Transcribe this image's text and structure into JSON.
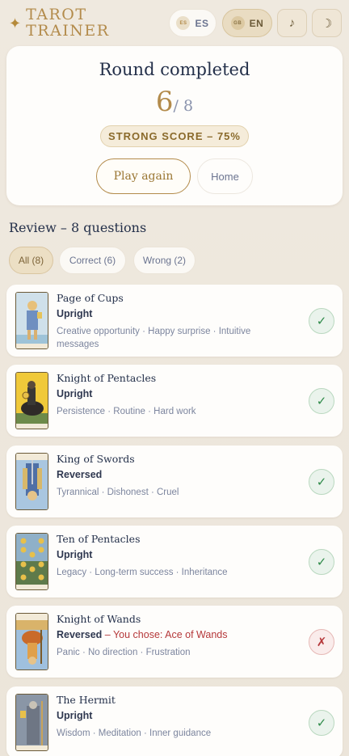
{
  "header": {
    "brand_line1": "TAROT",
    "brand_line2": "TRAINER",
    "star_icon": "✦",
    "lang_es": {
      "flag": "ES",
      "label": "ES"
    },
    "lang_en": {
      "flag": "GB",
      "label": "EN"
    },
    "music_icon": "♪",
    "moon_icon": "☽"
  },
  "score": {
    "title": "Round completed",
    "correct": "6",
    "total": "/ 8",
    "badge": "STRONG SCORE – 75%",
    "play_again": "Play again",
    "home": "Home"
  },
  "review": {
    "title": "Review – 8 questions",
    "filters": [
      "All (8)",
      "Correct (6)",
      "Wrong (2)"
    ],
    "selected_filter": "All (8)"
  },
  "cards": [
    {
      "name": "Page of Cups",
      "orientation": "Upright",
      "chose": "",
      "keywords": "Creative opportunity · Happy surprise · Intuitive messages",
      "result": "✓",
      "correct": true
    },
    {
      "name": "Knight of Pentacles",
      "orientation": "Upright",
      "chose": "",
      "keywords": "Persistence · Routine · Hard work",
      "result": "✓",
      "correct": true
    },
    {
      "name": "King of Swords",
      "orientation": "Reversed",
      "chose": "",
      "keywords": "Tyrannical · Dishonest · Cruel",
      "result": "✓",
      "correct": true
    },
    {
      "name": "Ten of Pentacles",
      "orientation": "Upright",
      "chose": "",
      "keywords": "Legacy · Long-term success · Inheritance",
      "result": "✓",
      "correct": true
    },
    {
      "name": "Knight of Wands",
      "orientation": "Reversed",
      "chose": " – You chose: Ace of Wands",
      "keywords": "Panic · No direction · Frustration",
      "result": "✗",
      "correct": false
    },
    {
      "name": "The Hermit",
      "orientation": "Upright",
      "chose": "",
      "keywords": "Wisdom · Meditation · Inner guidance",
      "result": "✓",
      "correct": true
    }
  ],
  "colors": {
    "accent": "#b38b4b",
    "ok": "#2e8a49",
    "wrong": "#b5383a"
  }
}
